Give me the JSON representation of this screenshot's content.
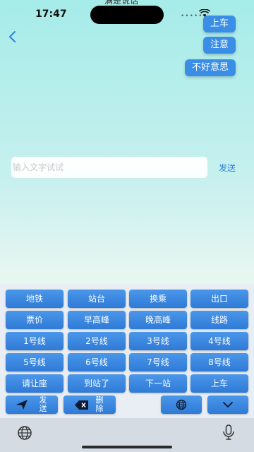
{
  "status": {
    "time": "17:47",
    "partial_title": "满是说话",
    "signal": "•••••"
  },
  "phrases": [
    {
      "label": "上车"
    },
    {
      "label": "注意"
    },
    {
      "label": "不好意思"
    }
  ],
  "input": {
    "placeholder": "输入文字试试",
    "value": ""
  },
  "send_label": "发送",
  "keyboard": {
    "rows": [
      [
        "地铁",
        "站台",
        "换乘",
        "出口"
      ],
      [
        "票价",
        "早高峰",
        "晚高峰",
        "线路"
      ],
      [
        "1号线",
        "2号线",
        "3号线",
        "4号线"
      ],
      [
        "5号线",
        "6号线",
        "7号线",
        "8号线"
      ],
      [
        "请让座",
        "到站了",
        "下一站",
        "上车"
      ]
    ],
    "send_label_top": "发",
    "send_label_bottom": "送",
    "delete_label_top": "删",
    "delete_label_bottom": "除"
  }
}
